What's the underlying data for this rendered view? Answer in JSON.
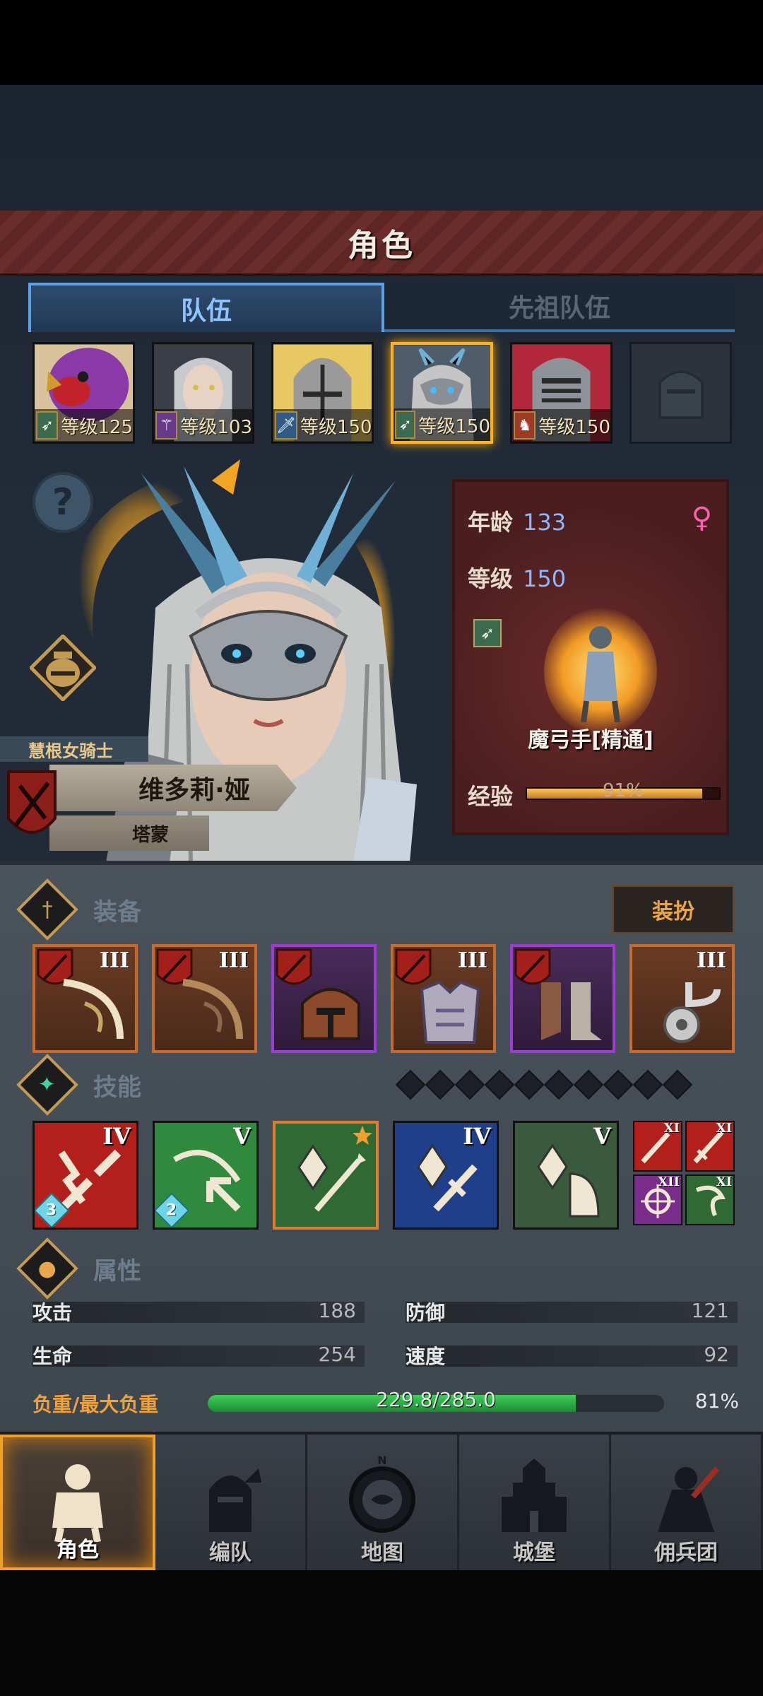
{
  "header": {
    "title": "角色"
  },
  "tabs": [
    {
      "label": "队伍",
      "active": true
    },
    {
      "label": "先祖队伍",
      "active": false
    }
  ],
  "party": [
    {
      "level_text": "等级125",
      "class_icon": "bow-icon",
      "accent": "#b53a2a"
    },
    {
      "level_text": "等级103",
      "class_icon": "staff-icon",
      "accent": "#9aa0a8"
    },
    {
      "level_text": "等级150",
      "class_icon": "sword-icon",
      "accent": "#c9a24a"
    },
    {
      "level_text": "等级150",
      "class_icon": "bow-icon",
      "accent": "#5a6c7a",
      "selected": true
    },
    {
      "level_text": "等级150",
      "class_icon": "horse-icon",
      "accent": "#8a8f96"
    },
    {
      "level_text": "",
      "class_icon": "empty-slot-icon",
      "accent": "#2c333d",
      "empty": true
    }
  ],
  "hero": {
    "title": "慧根女骑士",
    "name": "维多莉·娅",
    "origin": "塔蒙",
    "age_label": "年龄",
    "age": "133",
    "level_label": "等级",
    "level": "150",
    "gender_icon": "female-icon",
    "class_name": "魔弓手[精通]",
    "exp_label": "经验",
    "exp_text": "91%",
    "exp_fraction": 0.91
  },
  "equipment": {
    "label": "装备",
    "dress_button": "装扮",
    "items": [
      {
        "tier": "III",
        "name": "bow-icon",
        "rarity": "legendary"
      },
      {
        "tier": "III",
        "name": "bow-icon",
        "rarity": "legendary"
      },
      {
        "tier": "",
        "name": "helmet-icon",
        "rarity": "epic"
      },
      {
        "tier": "III",
        "name": "armor-icon",
        "rarity": "legendary"
      },
      {
        "tier": "",
        "name": "boots-icon",
        "rarity": "epic"
      },
      {
        "tier": "III",
        "name": "horn-icon",
        "rarity": "legendary"
      }
    ]
  },
  "skills": {
    "label": "技能",
    "pip_count": 10,
    "items": [
      {
        "tier": "IV",
        "count": "3",
        "color": "#b3201b",
        "name": "broken-sword-skill-icon"
      },
      {
        "tier": "V",
        "count": "2",
        "color": "#2f8a3e",
        "name": "arrow-burst-skill-icon"
      },
      {
        "tier": "",
        "count": "",
        "color": "#2f6a35",
        "name": "crystal-arrow-skill-icon",
        "starred": true
      },
      {
        "tier": "IV",
        "count": "",
        "color": "#1f3f8a",
        "name": "crystal-sword-skill-icon"
      },
      {
        "tier": "V",
        "count": "",
        "color": "#3a5a3e",
        "name": "crystal-shield-skill-icon"
      }
    ],
    "mini": [
      {
        "tier": "XI",
        "color": "#b3201b",
        "name": "dagger-skill-icon"
      },
      {
        "tier": "XI",
        "color": "#b3201b",
        "name": "sword-skill-icon"
      },
      {
        "tier": "XII",
        "color": "#7a2d8a",
        "name": "target-skill-icon"
      },
      {
        "tier": "XI",
        "color": "#2f6a35",
        "name": "wind-skill-icon"
      }
    ]
  },
  "attributes": {
    "label": "属性",
    "attack_label": "攻击",
    "attack": "188",
    "defense_label": "防御",
    "defense": "121",
    "hp_label": "生命",
    "hp": "254",
    "speed_label": "速度",
    "speed": "92",
    "load_label": "负重/最大负重",
    "load_text": "229.8/285.0",
    "load_pct": "81%",
    "load_fraction": 0.806
  },
  "nav": [
    {
      "label": "角色",
      "icon": "knight-icon",
      "active": true
    },
    {
      "label": "编队",
      "icon": "formation-icon"
    },
    {
      "label": "地图",
      "icon": "compass-map-icon"
    },
    {
      "label": "城堡",
      "icon": "castle-icon"
    },
    {
      "label": "佣兵团",
      "icon": "mercenary-icon"
    }
  ],
  "colors": {
    "accent_orange": "#f0a02a",
    "tab_blue": "#5aa2e6",
    "banner_red": "#6a2d2a"
  }
}
